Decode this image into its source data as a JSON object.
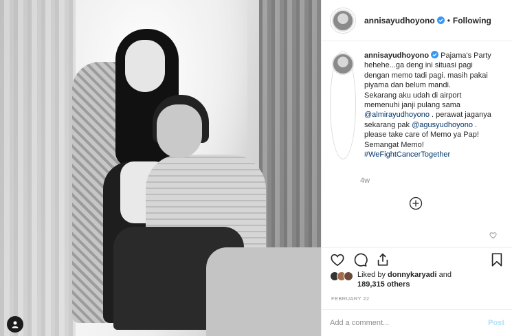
{
  "post": {
    "photo_description_tag": "",
    "user_tag_icon": "person-icon"
  },
  "header": {
    "username": "annisayudhoyono",
    "separator": "•",
    "follow_status": "Following"
  },
  "caption": {
    "username": "annisayudhoyono",
    "line1": " Pajama's Party\nhehehe...ga deng ini situasi pagi\ndengan memo tadi pagi. masih pakai\npiyama dan belum mandi.\nSekarang aku udah di airport\nmemenuhi janji pulang sama\n",
    "mention1": "@almirayudhoyono",
    "line2": " . perawat jaganya\nsekarang pak ",
    "mention2": "@agusyudhoyono",
    "line3": " .\nplease take care of Memo ya Pap!\nSemangat Memo!\n",
    "hashtag": "#WeFightCancerTogether",
    "time_ago": "4w"
  },
  "likes": {
    "prefix": "Liked by ",
    "first_liker": "donnykaryadi",
    "middle": " and",
    "count": "189,315 others"
  },
  "date": "FEBRUARY 22",
  "comment": {
    "placeholder": "Add a comment...",
    "post_label": "Post"
  },
  "colors": {
    "verified": "#3897f0",
    "link": "#003569",
    "post_disabled": "#b2dffc",
    "muted": "#8e8e8e"
  }
}
